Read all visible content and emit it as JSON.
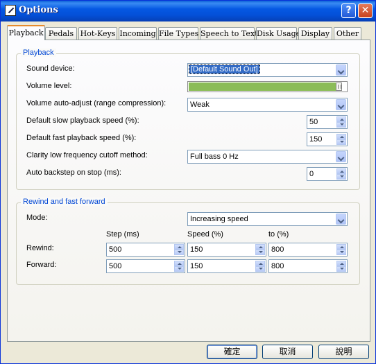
{
  "window": {
    "title": "Options"
  },
  "tabs": [
    "Playback",
    "Pedals",
    "Hot-Keys",
    "Incoming",
    "File Types",
    "Speech to Text",
    "Disk Usage",
    "Display",
    "Other"
  ],
  "playback_group": {
    "title": "Playback",
    "sound_device": {
      "label": "Sound device:",
      "value": "[Default Sound Out]"
    },
    "volume": {
      "label": "Volume level:",
      "level": 0.94
    },
    "auto_adjust": {
      "label": "Volume auto-adjust (range compression):",
      "value": "Weak"
    },
    "slow_speed": {
      "label": "Default slow playback speed (%):",
      "value": "50"
    },
    "fast_speed": {
      "label": "Default fast playback speed (%):",
      "value": "150"
    },
    "clarity": {
      "label": "Clarity low frequency cutoff method:",
      "value": "Full bass 0 Hz"
    },
    "backstep": {
      "label": "Auto backstep on stop (ms):",
      "value": "0"
    }
  },
  "rewind_group": {
    "title": "Rewind and fast forward",
    "mode": {
      "label": "Mode:",
      "value": "Increasing speed"
    },
    "columns": [
      "Step (ms)",
      "Speed (%)",
      "to (%)"
    ],
    "rewind": {
      "label": "Rewind:",
      "step": "500",
      "speed": "150",
      "to": "800"
    },
    "forward": {
      "label": "Forward:",
      "step": "500",
      "speed": "150",
      "to": "800"
    }
  },
  "buttons": {
    "ok": "確定",
    "cancel": "取消",
    "help": "說明"
  },
  "colors": {
    "accent": "#0046d5",
    "title_bar": "#0558e3",
    "volume_fill": "#8bbc57"
  }
}
